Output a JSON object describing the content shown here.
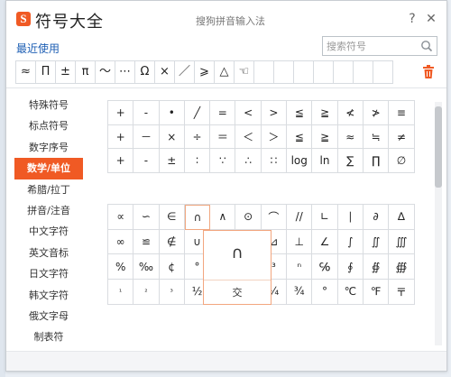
{
  "background": {
    "edge_text_1": "",
    "edge_text_2": ""
  },
  "window": {
    "app_title": "符号大全",
    "logo_letter": "S",
    "title": "搜狗拼音输入法",
    "help_glyph": "?",
    "close_glyph": "✕"
  },
  "recent": {
    "label": "最近使用",
    "symbols": [
      "≈",
      "Π",
      "±",
      "π",
      "～",
      "⋯",
      "Ω",
      "×",
      "／",
      "⩾",
      "△",
      "☜",
      "",
      "",
      "",
      "",
      "",
      "",
      ""
    ]
  },
  "search": {
    "placeholder": "搜索符号"
  },
  "sidebar": {
    "items": [
      {
        "label": "特殊符号",
        "active": false
      },
      {
        "label": "标点符号",
        "active": false
      },
      {
        "label": "数字序号",
        "active": false
      },
      {
        "label": "数学/单位",
        "active": true
      },
      {
        "label": "希腊/拉丁",
        "active": false
      },
      {
        "label": "拼音/注音",
        "active": false
      },
      {
        "label": "中文字符",
        "active": false
      },
      {
        "label": "英文音标",
        "active": false
      },
      {
        "label": "日文字符",
        "active": false
      },
      {
        "label": "韩文字符",
        "active": false
      },
      {
        "label": "俄文字母",
        "active": false
      },
      {
        "label": "制表符",
        "active": false
      }
    ]
  },
  "grid1": [
    [
      "+",
      "-",
      "•",
      "╱",
      "=",
      "<",
      ">",
      "≦",
      "≧",
      "≮",
      "≯",
      "≡"
    ],
    [
      "+",
      "－",
      "×",
      "÷",
      "＝",
      "＜",
      "＞",
      "≦",
      "≧",
      "≈",
      "≒",
      "≠"
    ],
    [
      "+",
      "-",
      "±",
      "∶",
      "∵",
      "∴",
      "∷",
      "log",
      "ln",
      "∑",
      "∏",
      "∅"
    ]
  ],
  "grid2": [
    [
      "∝",
      "∽",
      "∈",
      "∩",
      "∧",
      "⊙",
      "⌒",
      "//",
      "∟",
      "∣",
      "∂",
      "∆"
    ],
    [
      "∞",
      "≌",
      "∉",
      "∪",
      "∨",
      "⊕",
      "⊿",
      "⊥",
      "∠",
      "∫",
      "∬",
      "∭"
    ],
    [
      "%",
      "‰",
      "¢",
      "°",
      "′",
      "″",
      "³",
      "ⁿ",
      "℅",
      "∮",
      "∯",
      "∰"
    ],
    [
      "¹",
      "²",
      "³",
      "½",
      "⅓",
      "¼",
      "¼",
      "¾",
      "°",
      "℃",
      "℉",
      "〒"
    ]
  ],
  "popup": {
    "symbol": "∩",
    "name": "交"
  }
}
